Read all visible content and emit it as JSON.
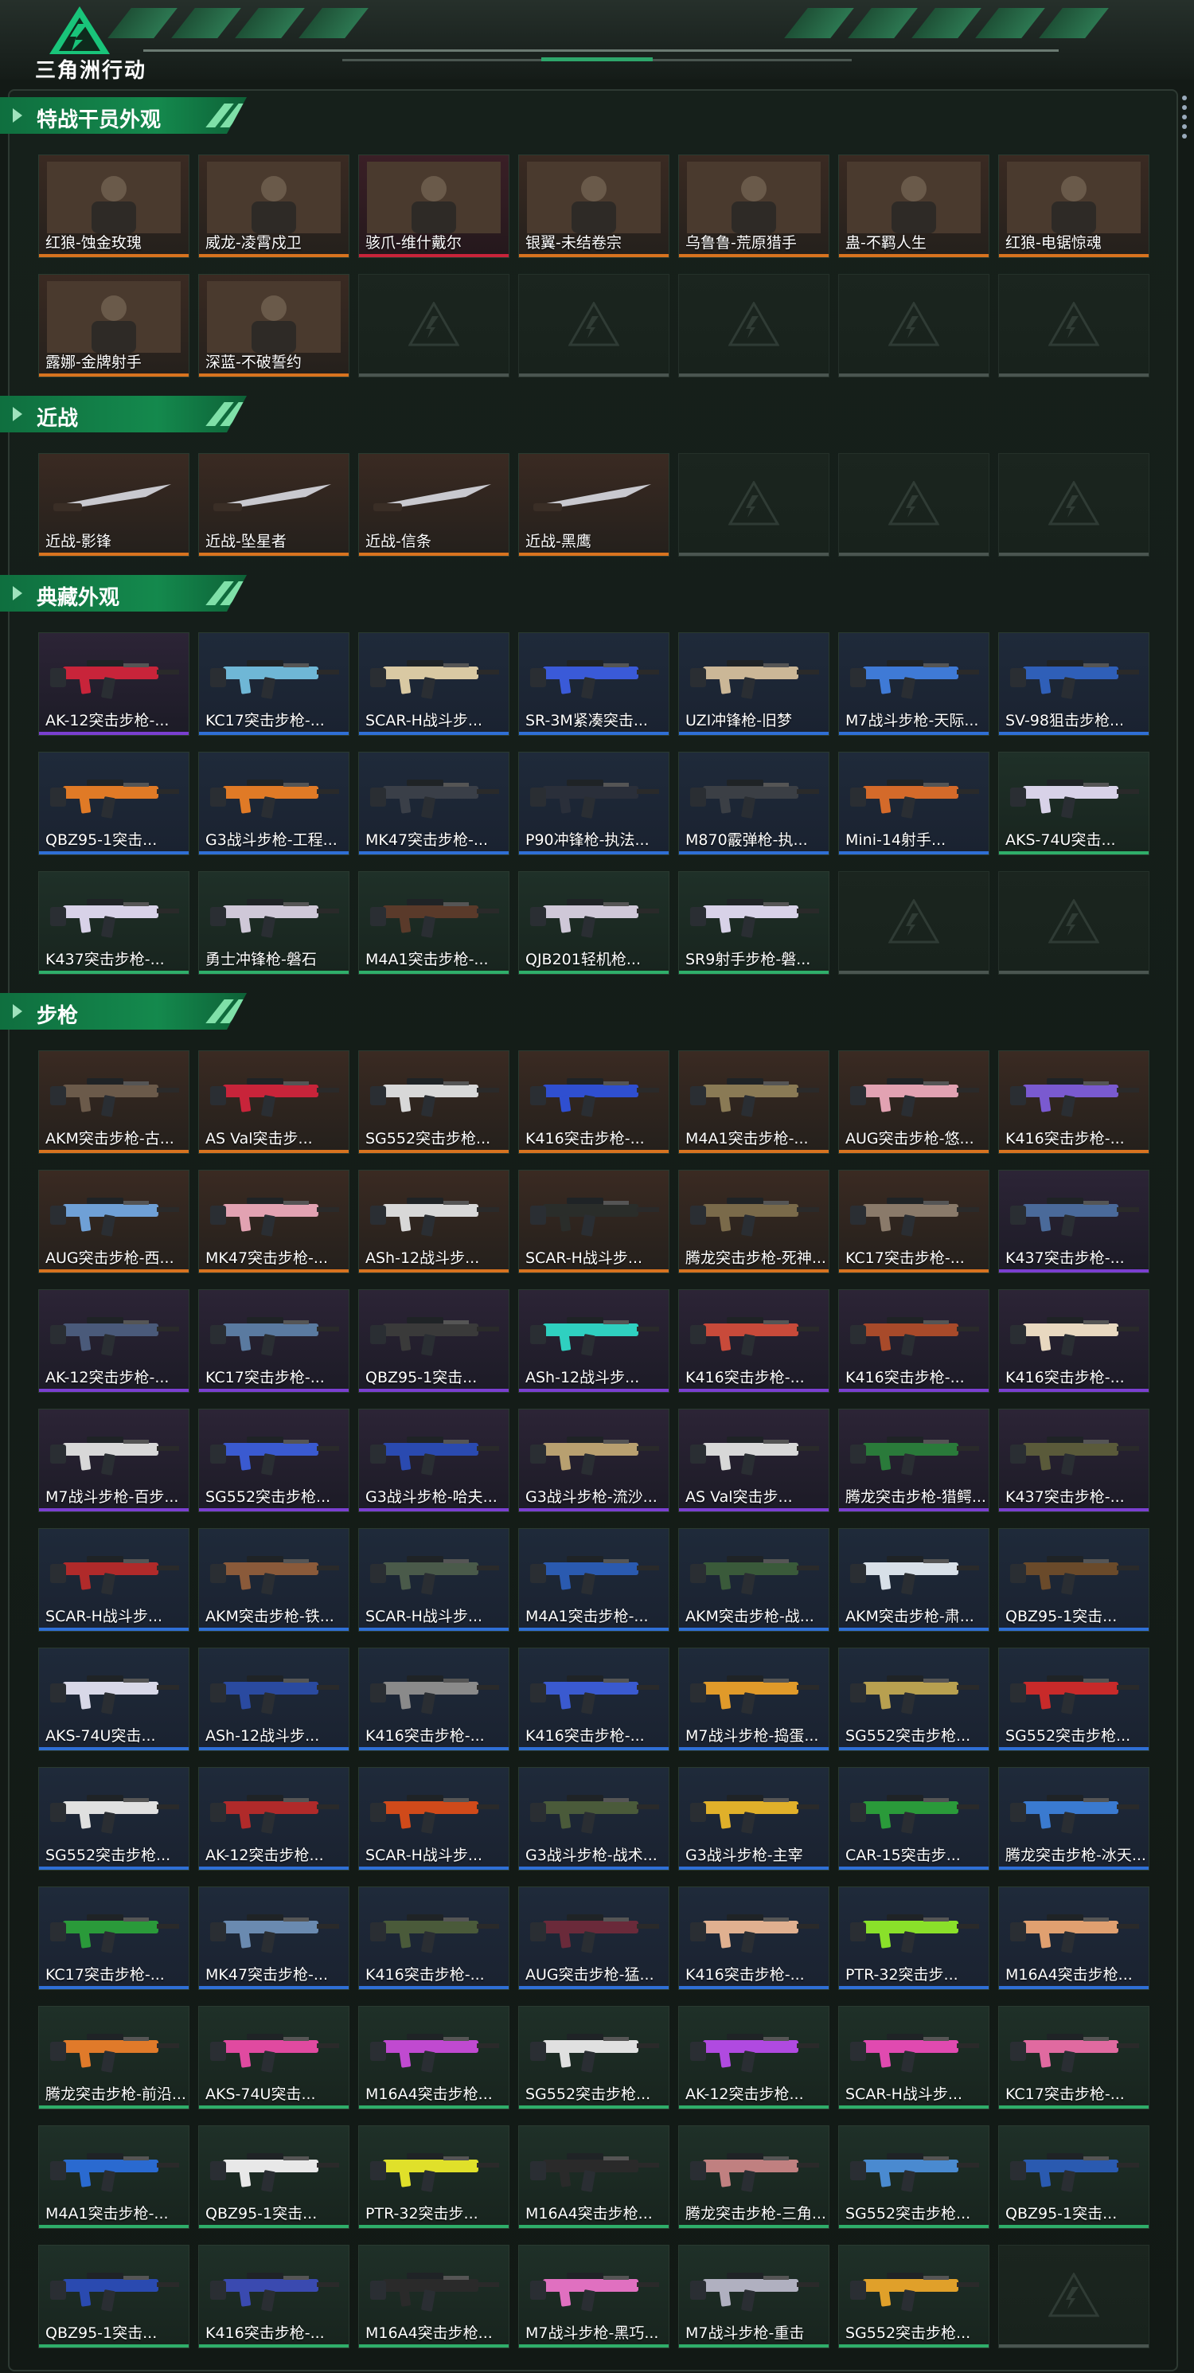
{
  "app": {
    "title": "三角洲行动"
  },
  "sections": [
    {
      "title": "特战干员外观",
      "cols": 7,
      "cells": 14,
      "items": [
        {
          "name": "红狼-蚀金玫瑰",
          "rarity": "orange",
          "thumb": "operator",
          "badge": "蚀金玫瑰"
        },
        {
          "name": "威龙-凌霄戍卫",
          "rarity": "orange",
          "thumb": "operator",
          "badge": "凌霄戍卫"
        },
        {
          "name": "骇爪-维什戴尔",
          "rarity": "red",
          "thumb": "operator",
          "badge": "维什戴尔"
        },
        {
          "name": "银翼-未结卷宗",
          "rarity": "orange",
          "thumb": "operator",
          "badge": "未结卷宗"
        },
        {
          "name": "乌鲁鲁-荒原猎手",
          "rarity": "orange",
          "thumb": "operator",
          "badge": ""
        },
        {
          "name": "蛊-不羁人生",
          "rarity": "orange",
          "thumb": "operator",
          "badge": ""
        },
        {
          "name": "红狼-电锯惊魂",
          "rarity": "orange",
          "thumb": "operator",
          "badge": ""
        },
        {
          "name": "露娜-金牌射手",
          "rarity": "orange",
          "thumb": "operator",
          "badge": ""
        },
        {
          "name": "深蓝-不破誓约",
          "rarity": "orange",
          "thumb": "operator",
          "badge": "不破誓约"
        }
      ]
    },
    {
      "title": "近战",
      "cols": 7,
      "cells": 7,
      "items": [
        {
          "name": "近战-影锋",
          "rarity": "orange",
          "thumb": "melee"
        },
        {
          "name": "近战-坠星者",
          "rarity": "orange",
          "thumb": "melee"
        },
        {
          "name": "近战-信条",
          "rarity": "orange",
          "thumb": "melee"
        },
        {
          "name": "近战-黑鹰",
          "rarity": "orange",
          "thumb": "melee"
        }
      ]
    },
    {
      "title": "典藏外观",
      "cols": 7,
      "cells": 21,
      "items": [
        {
          "name": "AK-12突击步枪-...",
          "rarity": "purple",
          "thumb": "gun",
          "accent": "#c8243a"
        },
        {
          "name": "KC17突击步枪-...",
          "rarity": "blue",
          "thumb": "gun",
          "accent": "#6fb7d6"
        },
        {
          "name": "SCAR-H战斗步...",
          "rarity": "blue",
          "thumb": "gun",
          "accent": "#d9c9a3"
        },
        {
          "name": "SR-3M紧凑突击...",
          "rarity": "blue",
          "thumb": "gun",
          "accent": "#3a5ad8"
        },
        {
          "name": "UZI冲锋枪-旧梦",
          "rarity": "blue",
          "thumb": "gun",
          "accent": "#cbb797"
        },
        {
          "name": "M7战斗步枪-天际...",
          "rarity": "blue",
          "thumb": "gun",
          "accent": "#3f7ad6"
        },
        {
          "name": "SV-98狙击步枪...",
          "rarity": "blue",
          "thumb": "gun",
          "accent": "#2f5fb8"
        },
        {
          "name": "QBZ95-1突击...",
          "rarity": "blue",
          "thumb": "gun",
          "accent": "#e07a26"
        },
        {
          "name": "G3战斗步枪-工程...",
          "rarity": "blue",
          "thumb": "gun",
          "accent": "#e07a26"
        },
        {
          "name": "MK47突击步枪-...",
          "rarity": "blue",
          "thumb": "gun",
          "accent": "#3a3f48"
        },
        {
          "name": "P90冲锋枪-执法...",
          "rarity": "blue",
          "thumb": "gun",
          "accent": "#2a2f3a"
        },
        {
          "name": "M870霰弹枪-执...",
          "rarity": "blue",
          "thumb": "gun",
          "accent": "#3b3f45"
        },
        {
          "name": "Mini-14射手...",
          "rarity": "blue",
          "thumb": "gun",
          "accent": "#d46a2a"
        },
        {
          "name": "AKS-74U突击...",
          "rarity": "green",
          "thumb": "gun",
          "accent": "#d8d2e8"
        },
        {
          "name": "K437突击步枪-...",
          "rarity": "green",
          "thumb": "gun",
          "accent": "#d8d2e8"
        },
        {
          "name": "勇士冲锋枪-磐石",
          "rarity": "green",
          "thumb": "gun",
          "accent": "#cfc8d8"
        },
        {
          "name": "M4A1突击步枪-...",
          "rarity": "green",
          "thumb": "gun",
          "accent": "#5a3a2a"
        },
        {
          "name": "QJB201轻机枪...",
          "rarity": "green",
          "thumb": "gun",
          "accent": "#cfc8d8"
        },
        {
          "name": "SR9射手步枪-磐...",
          "rarity": "green",
          "thumb": "gun",
          "accent": "#d8d2e8"
        }
      ]
    },
    {
      "title": "步枪",
      "cols": 7,
      "cells": 77,
      "items": [
        {
          "name": "AKM突击步枪-古...",
          "rarity": "orange",
          "thumb": "gun",
          "accent": "#6b5a4a"
        },
        {
          "name": "AS Val突击步...",
          "rarity": "orange",
          "thumb": "gun",
          "accent": "#c8243a"
        },
        {
          "name": "SG552突击步枪...",
          "rarity": "orange",
          "thumb": "gun",
          "accent": "#d8d8d8"
        },
        {
          "name": "K416突击步枪-...",
          "rarity": "orange",
          "thumb": "gun",
          "accent": "#2f4fd0"
        },
        {
          "name": "M4A1突击步枪-...",
          "rarity": "orange",
          "thumb": "gun",
          "accent": "#8a7a55"
        },
        {
          "name": "AUG突击步枪-悠...",
          "rarity": "orange",
          "thumb": "gun",
          "accent": "#e2a2b2"
        },
        {
          "name": "K416突击步枪-...",
          "rarity": "orange",
          "thumb": "gun",
          "accent": "#7a5ad0"
        },
        {
          "name": "AUG突击步枪-西...",
          "rarity": "orange",
          "thumb": "gun",
          "accent": "#6fa0d6"
        },
        {
          "name": "MK47突击步枪-...",
          "rarity": "orange",
          "thumb": "gun",
          "accent": "#e2a2b2"
        },
        {
          "name": "ASh-12战斗步...",
          "rarity": "orange",
          "thumb": "gun",
          "accent": "#d8d8d8"
        },
        {
          "name": "SCAR-H战斗步...",
          "rarity": "orange",
          "thumb": "gun",
          "accent": "#2a2d2a"
        },
        {
          "name": "腾龙突击步枪-死神...",
          "rarity": "orange",
          "thumb": "gun",
          "accent": "#7a6a4a"
        },
        {
          "name": "KC17突击步枪-...",
          "rarity": "orange",
          "thumb": "gun",
          "accent": "#8a7a6a"
        },
        {
          "name": "K437突击步枪-...",
          "rarity": "purple",
          "thumb": "gun",
          "accent": "#4a6a9a"
        },
        {
          "name": "AK-12突击步枪-...",
          "rarity": "purple",
          "thumb": "gun",
          "accent": "#4a5a7a"
        },
        {
          "name": "KC17突击步枪-...",
          "rarity": "purple",
          "thumb": "gun",
          "accent": "#5a7aa0"
        },
        {
          "name": "QBZ95-1突击...",
          "rarity": "purple",
          "thumb": "gun",
          "accent": "#3a3a3a"
        },
        {
          "name": "ASh-12战斗步...",
          "rarity": "purple",
          "thumb": "gun",
          "accent": "#2fd0c0"
        },
        {
          "name": "K416突击步枪-...",
          "rarity": "purple",
          "thumb": "gun",
          "accent": "#c84a3a"
        },
        {
          "name": "K416突击步枪-...",
          "rarity": "purple",
          "thumb": "gun",
          "accent": "#a84a2a"
        },
        {
          "name": "K416突击步枪-...",
          "rarity": "purple",
          "thumb": "gun",
          "accent": "#e8d8c0"
        },
        {
          "name": "M7战斗步枪-百步...",
          "rarity": "purple",
          "thumb": "gun",
          "accent": "#d8d8d8"
        },
        {
          "name": "SG552突击步枪...",
          "rarity": "purple",
          "thumb": "gun",
          "accent": "#3a5ad0"
        },
        {
          "name": "G3战斗步枪-哈夫...",
          "rarity": "purple",
          "thumb": "gun",
          "accent": "#2a4ab0"
        },
        {
          "name": "G3战斗步枪-流沙...",
          "rarity": "purple",
          "thumb": "gun",
          "accent": "#b8a070"
        },
        {
          "name": "AS Val突击步...",
          "rarity": "purple",
          "thumb": "gun",
          "accent": "#d8d8d8"
        },
        {
          "name": "腾龙突击步枪-猎鳄...",
          "rarity": "purple",
          "thumb": "gun",
          "accent": "#2a7a3a"
        },
        {
          "name": "K437突击步枪-...",
          "rarity": "purple",
          "thumb": "gun",
          "accent": "#5a5a3a"
        },
        {
          "name": "SCAR-H战斗步...",
          "rarity": "blue",
          "thumb": "gun",
          "accent": "#b02a2a"
        },
        {
          "name": "AKM突击步枪-铁...",
          "rarity": "blue",
          "thumb": "gun",
          "accent": "#8a5a3a"
        },
        {
          "name": "SCAR-H战斗步...",
          "rarity": "blue",
          "thumb": "gun",
          "accent": "#4a5a4a"
        },
        {
          "name": "M4A1突击步枪-...",
          "rarity": "blue",
          "thumb": "gun",
          "accent": "#2a5ab0"
        },
        {
          "name": "AKM突击步枪-战...",
          "rarity": "blue",
          "thumb": "gun",
          "accent": "#3a5a3a"
        },
        {
          "name": "AKM突击步枪-肃...",
          "rarity": "blue",
          "thumb": "gun",
          "accent": "#d8e0e8"
        },
        {
          "name": "QBZ95-1突击...",
          "rarity": "blue",
          "thumb": "gun",
          "accent": "#6a4a2a"
        },
        {
          "name": "AKS-74U突击...",
          "rarity": "blue",
          "thumb": "gun",
          "accent": "#d8d8e8"
        },
        {
          "name": "ASh-12战斗步...",
          "rarity": "blue",
          "thumb": "gun",
          "accent": "#2a4aa0"
        },
        {
          "name": "K416突击步枪-...",
          "rarity": "blue",
          "thumb": "gun",
          "accent": "#8a8a8a"
        },
        {
          "name": "K416突击步枪-...",
          "rarity": "blue",
          "thumb": "gun",
          "accent": "#3a5ad0"
        },
        {
          "name": "M7战斗步枪-捣蛋...",
          "rarity": "blue",
          "thumb": "gun",
          "accent": "#e09a2a"
        },
        {
          "name": "SG552突击步枪...",
          "rarity": "blue",
          "thumb": "gun",
          "accent": "#b8a050"
        },
        {
          "name": "SG552突击步枪...",
          "rarity": "blue",
          "thumb": "gun",
          "accent": "#c82a2a"
        },
        {
          "name": "SG552突击步枪...",
          "rarity": "blue",
          "thumb": "gun",
          "accent": "#e0e0e0"
        },
        {
          "name": "AK-12突击步枪...",
          "rarity": "blue",
          "thumb": "gun",
          "accent": "#b02a2a"
        },
        {
          "name": "SCAR-H战斗步...",
          "rarity": "blue",
          "thumb": "gun",
          "accent": "#d04a1a"
        },
        {
          "name": "G3战斗步枪-战术...",
          "rarity": "blue",
          "thumb": "gun",
          "accent": "#4a5a3a"
        },
        {
          "name": "G3战斗步枪-主宰",
          "rarity": "blue",
          "thumb": "gun",
          "accent": "#e0b02a"
        },
        {
          "name": "CAR-15突击步...",
          "rarity": "blue",
          "thumb": "gun",
          "accent": "#2a9a3a"
        },
        {
          "name": "腾龙突击步枪-冰天...",
          "rarity": "blue",
          "thumb": "gun",
          "accent": "#3a7ad0"
        },
        {
          "name": "KC17突击步枪-...",
          "rarity": "blue",
          "thumb": "gun",
          "accent": "#2a9a3a"
        },
        {
          "name": "MK47突击步枪-...",
          "rarity": "blue",
          "thumb": "gun",
          "accent": "#6a8ab0"
        },
        {
          "name": "K416突击步枪-...",
          "rarity": "blue",
          "thumb": "gun",
          "accent": "#4a5a3a"
        },
        {
          "name": "AUG突击步枪-猛...",
          "rarity": "blue",
          "thumb": "gun",
          "accent": "#6a2a3a"
        },
        {
          "name": "K416突击步枪-...",
          "rarity": "blue",
          "thumb": "gun",
          "accent": "#e0b090"
        },
        {
          "name": "PTR-32突击步...",
          "rarity": "blue",
          "thumb": "gun",
          "accent": "#8ae02a"
        },
        {
          "name": "M16A4突击步枪...",
          "rarity": "blue",
          "thumb": "gun",
          "accent": "#e0a070"
        },
        {
          "name": "腾龙突击步枪-前沿...",
          "rarity": "green",
          "thumb": "gun",
          "accent": "#e07a2a"
        },
        {
          "name": "AKS-74U突击...",
          "rarity": "green",
          "thumb": "gun",
          "accent": "#e04aa0"
        },
        {
          "name": "M16A4突击步枪...",
          "rarity": "green",
          "thumb": "gun",
          "accent": "#c04ad0"
        },
        {
          "name": "SG552突击步枪...",
          "rarity": "green",
          "thumb": "gun",
          "accent": "#e0e0e0"
        },
        {
          "name": "AK-12突击步枪...",
          "rarity": "green",
          "thumb": "gun",
          "accent": "#b04ae0"
        },
        {
          "name": "SCAR-H战斗步...",
          "rarity": "green",
          "thumb": "gun",
          "accent": "#e04ab0"
        },
        {
          "name": "KC17突击步枪-...",
          "rarity": "green",
          "thumb": "gun",
          "accent": "#e06aa0"
        },
        {
          "name": "M4A1突击步枪-...",
          "rarity": "green",
          "thumb": "gun",
          "accent": "#2a6ad0"
        },
        {
          "name": "QBZ95-1突击...",
          "rarity": "green",
          "thumb": "gun",
          "accent": "#e8e8e8"
        },
        {
          "name": "PTR-32突击步...",
          "rarity": "green",
          "thumb": "gun",
          "accent": "#e0e02a"
        },
        {
          "name": "M16A4突击步枪...",
          "rarity": "green",
          "thumb": "gun",
          "accent": "#2a2a2a"
        },
        {
          "name": "腾龙突击步枪-三角...",
          "rarity": "green",
          "thumb": "gun",
          "accent": "#c08080"
        },
        {
          "name": "SG552突击步枪...",
          "rarity": "green",
          "thumb": "gun",
          "accent": "#4a8ad0"
        },
        {
          "name": "QBZ95-1突击...",
          "rarity": "green",
          "thumb": "gun",
          "accent": "#2a5ab0"
        },
        {
          "name": "QBZ95-1突击...",
          "rarity": "green",
          "thumb": "gun",
          "accent": "#2a4ab0"
        },
        {
          "name": "K416突击步枪-...",
          "rarity": "green",
          "thumb": "gun",
          "accent": "#3a4ab0"
        },
        {
          "name": "M16A4突击步枪...",
          "rarity": "green",
          "thumb": "gun",
          "accent": "#2a2a2a"
        },
        {
          "name": "M7战斗步枪-黑巧...",
          "rarity": "green",
          "thumb": "gun",
          "accent": "#e070c0"
        },
        {
          "name": "M7战斗步枪-重击",
          "rarity": "green",
          "thumb": "gun",
          "accent": "#b0b0c0"
        },
        {
          "name": "SG552突击步枪...",
          "rarity": "green",
          "thumb": "gun",
          "accent": "#e0a02a"
        }
      ]
    }
  ],
  "colors": {
    "orange": "#d8731f",
    "red": "#c8243a",
    "purple": "#7a3fd0",
    "blue": "#2f6fd6",
    "green": "#2fae6a",
    "accent": "#14894d"
  }
}
